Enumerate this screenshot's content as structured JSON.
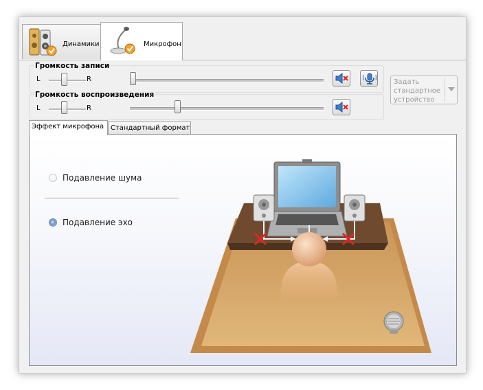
{
  "tabs": [
    {
      "label": "Динамики",
      "icon": "speakers-icon",
      "active": false
    },
    {
      "label": "Микрофон",
      "icon": "microphone-icon",
      "active": true
    }
  ],
  "record_volume": {
    "title": "Громкость записи",
    "left_label": "L",
    "right_label": "R",
    "balance": 0.5,
    "level": 0.0,
    "mute_icon": "speaker-muted-icon",
    "advanced_icon": "mic-settings-icon"
  },
  "playback_volume": {
    "title": "Громкость воспроизведения",
    "left_label": "L",
    "right_label": "R",
    "balance": 0.5,
    "level": 0.25,
    "mute_icon": "speaker-muted-icon"
  },
  "default_device": {
    "label": "Задать стандартное устройство",
    "enabled": false
  },
  "subtabs": [
    {
      "label": "Эффект микрофона",
      "active": true
    },
    {
      "label": "Стандартный формат",
      "active": false
    }
  ],
  "effects": [
    {
      "label": "Подавление шума",
      "selected": false
    },
    {
      "label": "Подавление эхо",
      "selected": true
    }
  ],
  "colors": {
    "desk_top": "#d7a86a",
    "desk_back": "#6f4a2e",
    "laptop_screen": "#7cc0ea",
    "cross": "#e32626"
  }
}
